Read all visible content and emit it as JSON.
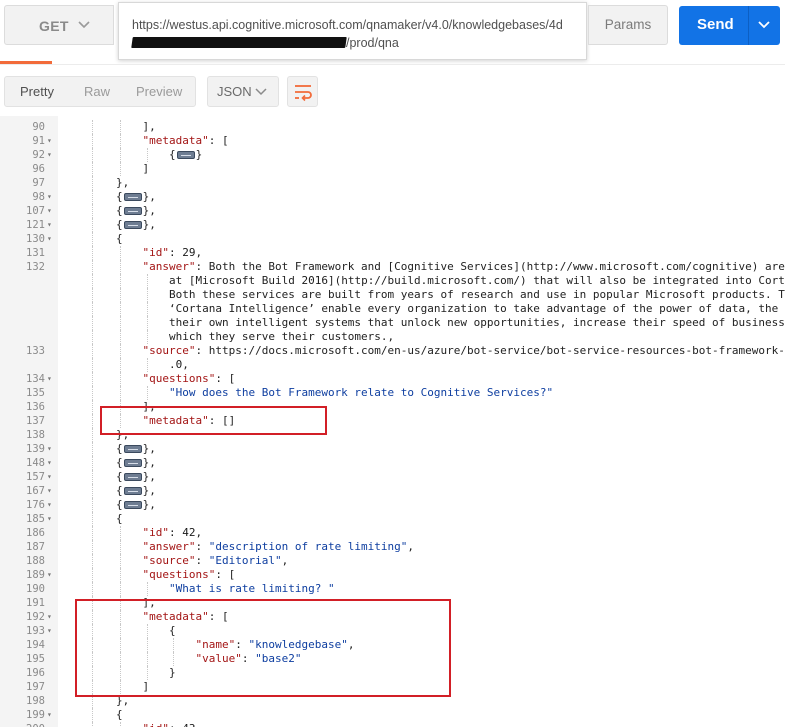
{
  "request": {
    "method": "GET",
    "url_line1": "https://westus.api.cognitive.microsoft.com/qnamaker/v4.0/knowledgebases/4d",
    "url_line2_suffix": "/prod/qna",
    "params_label": "Params",
    "send_label": "Send"
  },
  "response_toolbar": {
    "tabs": [
      "Pretty",
      "Raw",
      "Preview"
    ],
    "format": "JSON",
    "wrap_icon": "wrap-lines-icon"
  },
  "colors": {
    "send": "#1273e6",
    "active_tab_underline": "#f26b3a",
    "highlight_box": "#d21f26",
    "json_key": "#a31515",
    "json_string": "#0e3ea0"
  },
  "code_lines": [
    {
      "ln": "90",
      "fold": false,
      "indent": 3,
      "text": "],"
    },
    {
      "ln": "91",
      "fold": true,
      "indent": 3,
      "text": "\"metadata\": ["
    },
    {
      "ln": "92",
      "fold": true,
      "indent": 4,
      "text": "{⋯}"
    },
    {
      "ln": "96",
      "fold": false,
      "indent": 3,
      "text": "]"
    },
    {
      "ln": "97",
      "fold": false,
      "indent": 2,
      "text": "},"
    },
    {
      "ln": "98",
      "fold": true,
      "indent": 2,
      "text": "{⋯},"
    },
    {
      "ln": "107",
      "fold": true,
      "indent": 2,
      "text": "{⋯},"
    },
    {
      "ln": "121",
      "fold": true,
      "indent": 2,
      "text": "{⋯},"
    },
    {
      "ln": "130",
      "fold": true,
      "indent": 2,
      "text": "{"
    },
    {
      "ln": "131",
      "fold": false,
      "indent": 3,
      "text": "\"id\": 29,"
    },
    {
      "ln": "132",
      "fold": false,
      "indent": 3,
      "text": "\"answer\": \"Both the Bot Framework and [Cognitive Services](http://www.microsoft.com/cognitive) are"
    },
    {
      "ln": "",
      "fold": false,
      "indent": 4,
      "text": "at [Microsoft Build 2016](http://build.microsoft.com/) that will also be integrated into Corta"
    },
    {
      "ln": "",
      "fold": false,
      "indent": 4,
      "text": "Both these services are built from years of research and use in popular Microsoft products. Th"
    },
    {
      "ln": "",
      "fold": false,
      "indent": 4,
      "text": "‘Cortana Intelligence’ enable every organization to take advantage of the power of data, the c"
    },
    {
      "ln": "",
      "fold": false,
      "indent": 4,
      "text": "their own intelligent systems that unlock new opportunities, increase their speed of business"
    },
    {
      "ln": "",
      "fold": false,
      "indent": 4,
      "text": "which they serve their customers.\","
    },
    {
      "ln": "133",
      "fold": false,
      "indent": 3,
      "text": "\"source\": \"https://docs.microsoft.com/en-us/azure/bot-service/bot-service-resources-bot-framework-"
    },
    {
      "ln": "",
      "fold": false,
      "indent": 4,
      "text": ".0\","
    },
    {
      "ln": "134",
      "fold": true,
      "indent": 3,
      "text": "\"questions\": ["
    },
    {
      "ln": "135",
      "fold": false,
      "indent": 4,
      "text": "\"How does the Bot Framework relate to Cognitive Services?\""
    },
    {
      "ln": "136",
      "fold": false,
      "indent": 3,
      "text": "],"
    },
    {
      "ln": "137",
      "fold": false,
      "indent": 3,
      "text": "\"metadata\": []"
    },
    {
      "ln": "138",
      "fold": false,
      "indent": 2,
      "text": "},"
    },
    {
      "ln": "139",
      "fold": true,
      "indent": 2,
      "text": "{⋯},"
    },
    {
      "ln": "148",
      "fold": true,
      "indent": 2,
      "text": "{⋯},"
    },
    {
      "ln": "157",
      "fold": true,
      "indent": 2,
      "text": "{⋯},"
    },
    {
      "ln": "167",
      "fold": true,
      "indent": 2,
      "text": "{⋯},"
    },
    {
      "ln": "176",
      "fold": true,
      "indent": 2,
      "text": "{⋯},"
    },
    {
      "ln": "185",
      "fold": true,
      "indent": 2,
      "text": "{"
    },
    {
      "ln": "186",
      "fold": false,
      "indent": 3,
      "text": "\"id\": 42,"
    },
    {
      "ln": "187",
      "fold": false,
      "indent": 3,
      "text": "\"answer\": \"description of rate limiting\","
    },
    {
      "ln": "188",
      "fold": false,
      "indent": 3,
      "text": "\"source\": \"Editorial\","
    },
    {
      "ln": "189",
      "fold": true,
      "indent": 3,
      "text": "\"questions\": ["
    },
    {
      "ln": "190",
      "fold": false,
      "indent": 4,
      "text": "\"What is rate limiting? \""
    },
    {
      "ln": "191",
      "fold": false,
      "indent": 3,
      "text": "],"
    },
    {
      "ln": "192",
      "fold": true,
      "indent": 3,
      "text": "\"metadata\": ["
    },
    {
      "ln": "193",
      "fold": true,
      "indent": 4,
      "text": "{"
    },
    {
      "ln": "194",
      "fold": false,
      "indent": 5,
      "text": "\"name\": \"knowledgebase\","
    },
    {
      "ln": "195",
      "fold": false,
      "indent": 5,
      "text": "\"value\": \"base2\""
    },
    {
      "ln": "196",
      "fold": false,
      "indent": 4,
      "text": "}"
    },
    {
      "ln": "197",
      "fold": false,
      "indent": 3,
      "text": "]"
    },
    {
      "ln": "198",
      "fold": false,
      "indent": 2,
      "text": "},"
    },
    {
      "ln": "199",
      "fold": true,
      "indent": 2,
      "text": "{"
    },
    {
      "ln": "200",
      "fold": false,
      "indent": 3,
      "text": "\"id\": 43,"
    }
  ]
}
